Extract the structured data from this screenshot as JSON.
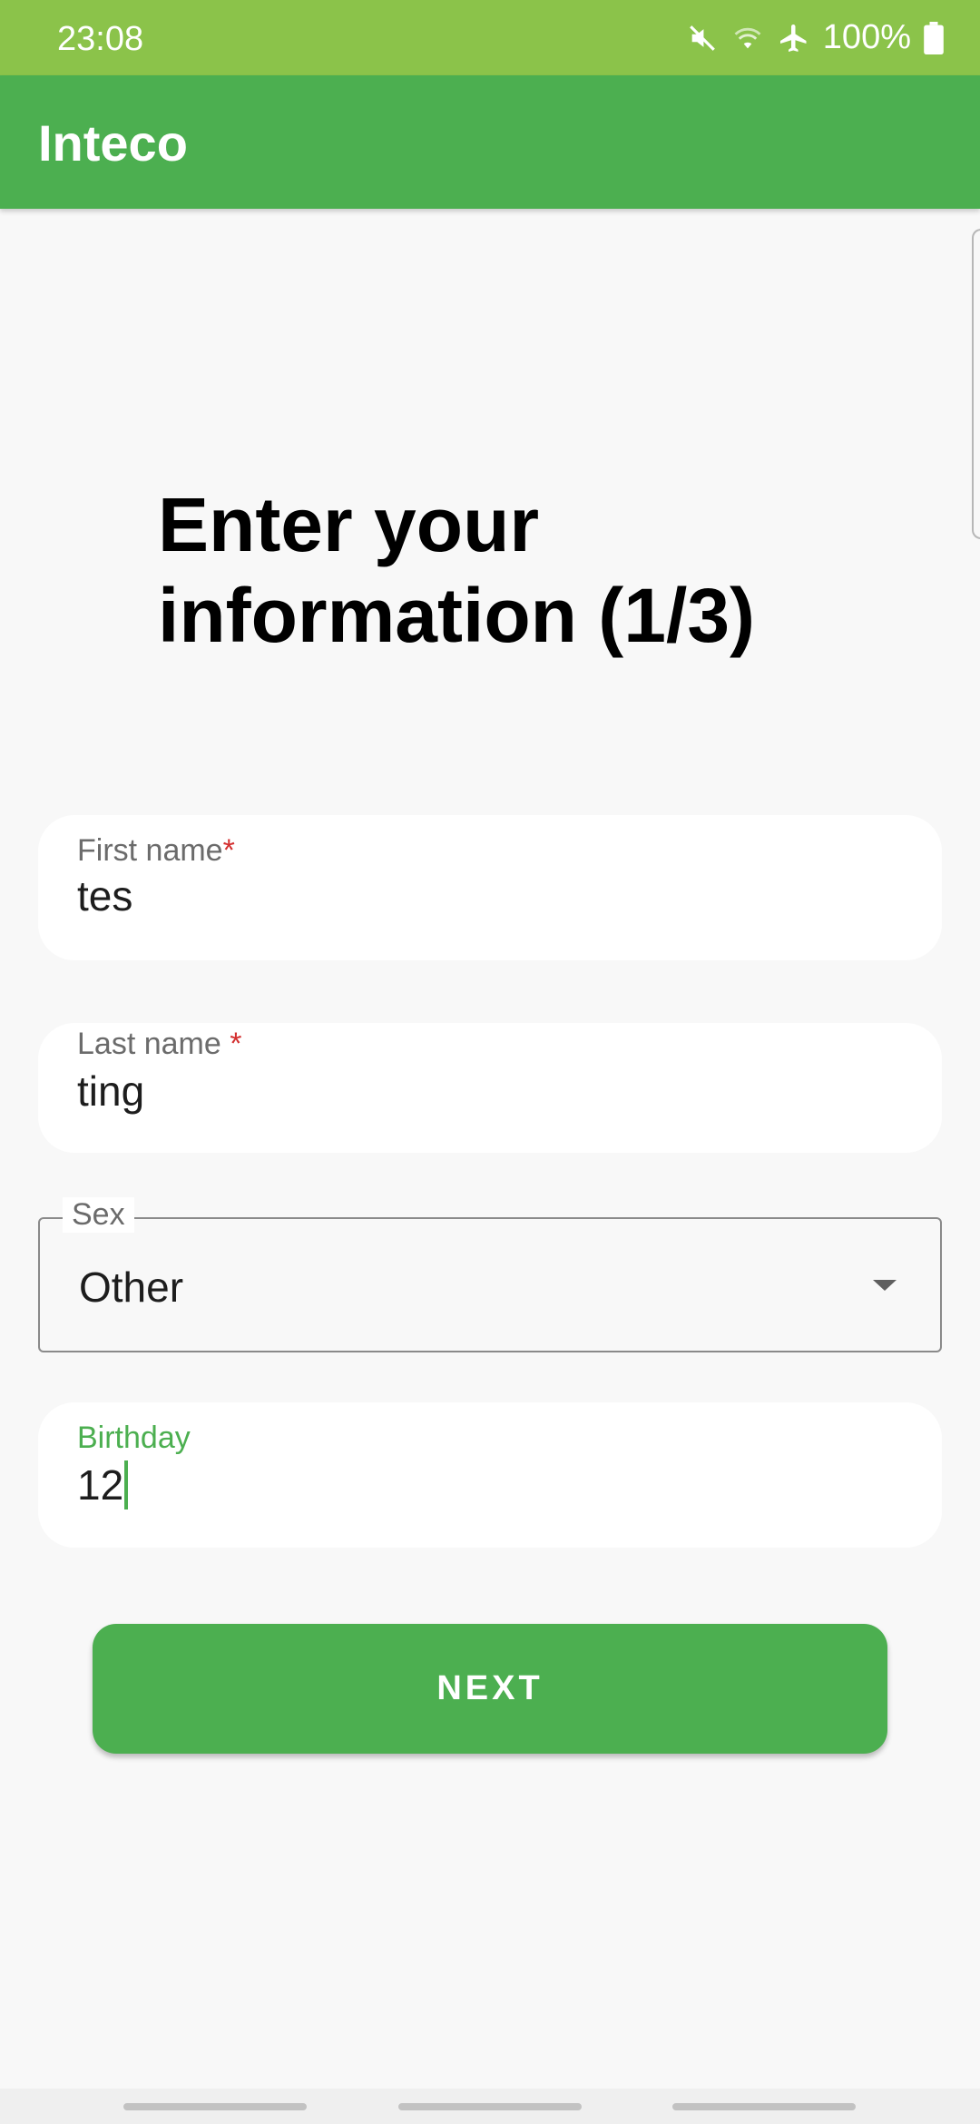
{
  "status_bar": {
    "time": "23:08",
    "battery": "100%",
    "icons": [
      "mute-icon",
      "wifi-icon",
      "airplane-icon",
      "battery-icon"
    ]
  },
  "app_bar": {
    "title": "Inteco"
  },
  "form": {
    "heading": "Enter your information (1/3)",
    "first_name": {
      "label": "First name",
      "required_marker": "*",
      "value": "tes"
    },
    "last_name": {
      "label": "Last name ",
      "required_marker": "*",
      "value": "ting"
    },
    "sex": {
      "label": "Sex",
      "selected": "Other"
    },
    "birthday": {
      "label": "Birthday",
      "value": "12"
    },
    "next_label": "NEXT"
  },
  "colors": {
    "status_bar": "#8bc34a",
    "app_bar": "#4caf50",
    "accent": "#4caf50",
    "required": "#d32f2f",
    "background": "#f8f8f8"
  }
}
